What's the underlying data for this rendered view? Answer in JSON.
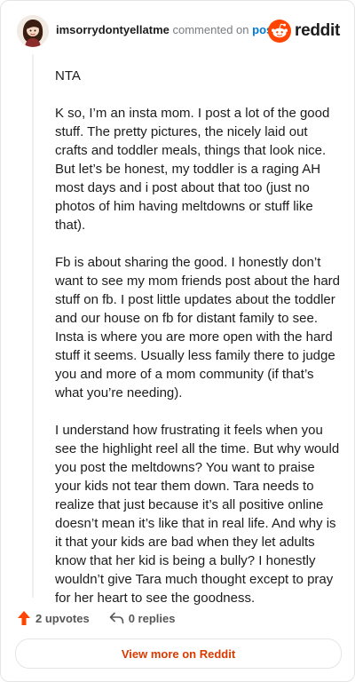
{
  "header": {
    "username": "imsorrydontyellatme",
    "action_text": "commented on",
    "target_link": "post",
    "brand_name": "reddit"
  },
  "comment": {
    "paragraphs": [
      "NTA",
      "K so, I’m an insta mom. I post a lot of the good stuff. The pretty pictures, the nicely laid out crafts and toddler meals, things that look nice. But let’s be honest, my toddler is a raging AH most days and i post about that too (just no photos of him having meltdowns or stuff like that).",
      "Fb is about sharing the good. I honestly don’t want to see my mom friends post about the hard stuff on fb. I post little updates about the toddler and our house on fb for distant family to see. Insta is where you are more open with the hard stuff it seems. Usually less family there to judge you and more of a mom community (if that’s what you’re needing).",
      "I understand how frustrating it feels when you see the highlight reel all the time. But why would you post the meltdowns? You want to praise your kids not tear them down. Tara needs to realize that just because it’s all positive online doesn’t mean it’s like that in real life. And why is it that your kids are bad when they let adults know that her kid is being a bully? I honestly wouldn’t give Tara much thought except to pray for her heart to see the goodness."
    ]
  },
  "actions": {
    "upvotes_label": "2 upvotes",
    "replies_label": "0 replies"
  },
  "footer": {
    "view_more_label": "View more on Reddit"
  },
  "colors": {
    "brand_orange": "#ff4500",
    "link_blue": "#0079d3",
    "view_more_text": "#d93a00"
  },
  "icons": {
    "avatar": "avatar-illustration",
    "brand": "reddit-snoo-icon",
    "upvote": "upvote-arrow-icon",
    "reply": "reply-arrow-icon"
  }
}
